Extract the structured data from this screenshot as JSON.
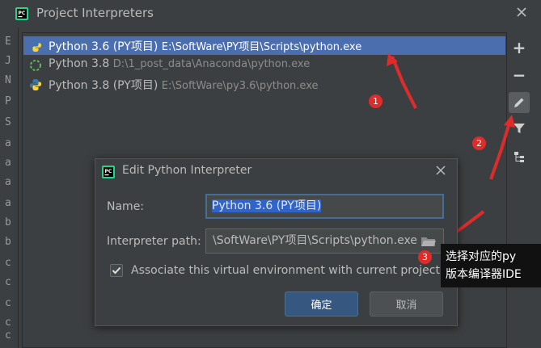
{
  "window": {
    "title": "Project Interpreters"
  },
  "left_strip": [
    "E",
    "J",
    "N",
    "P",
    "S",
    "a",
    "a",
    "a",
    "a",
    "b",
    "b",
    "c",
    "c",
    "c",
    "c",
    "c",
    "c"
  ],
  "interpreters": [
    {
      "name": "Python 3.6 (PY项目)",
      "path": "E:\\SoftWare\\PY项目\\Scripts\\python.exe",
      "icon": "python-icon",
      "selected": true
    },
    {
      "name": "Python 3.8",
      "path": "D:\\1_post_data\\Anaconda\\python.exe",
      "icon": "conda-loading-icon",
      "selected": false
    },
    {
      "name": "Python 3.8 (PY项目)",
      "path": "E:\\SoftWare\\py3.6\\python.exe",
      "icon": "python-icon",
      "selected": false
    }
  ],
  "toolbar": {
    "add": "+",
    "remove": "−"
  },
  "dialog": {
    "title": "Edit Python Interpreter",
    "name_label": "Name:",
    "name_value": "Python 3.6 (PY项目)",
    "path_label": "Interpreter path:",
    "path_value": "\\SoftWare\\PY项目\\Scripts\\python.exe",
    "checkbox_label": "Associate this virtual environment with current project",
    "checkbox_checked": true,
    "ok_label": "确定",
    "cancel_label": "取消"
  },
  "annotations": {
    "badges": [
      "1",
      "2",
      "3"
    ],
    "callout_line1": "选择对应的py",
    "callout_line2": "版本编译器IDE",
    "color": "#e02b2b"
  },
  "colors": {
    "selection": "#4b6eaf",
    "background": "#3c3f41",
    "ok_button": "#365880"
  }
}
